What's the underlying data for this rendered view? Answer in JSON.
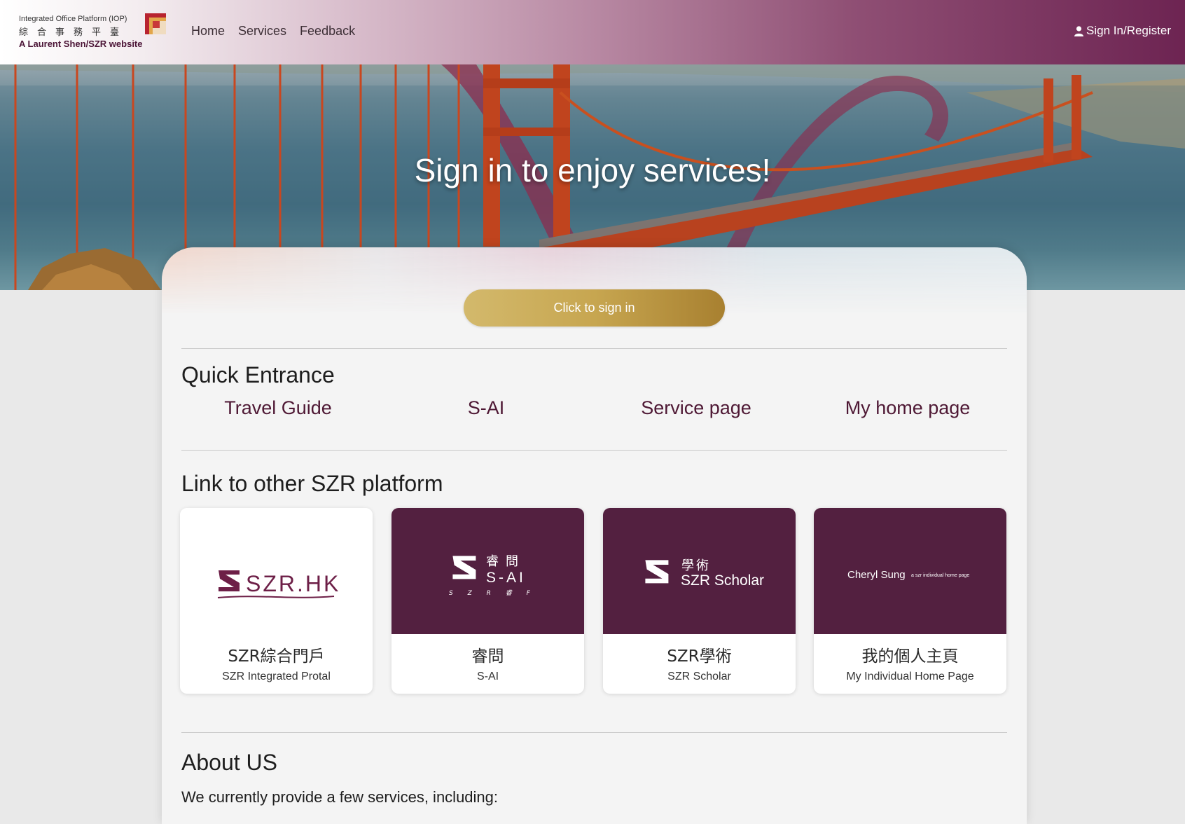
{
  "header": {
    "logo_en": "Integrated Office Platform (IOP)",
    "logo_zh": "綜合事務平臺",
    "logo_sub": "A Laurent Shen/SZR website",
    "nav": [
      "Home",
      "Services",
      "Feedback"
    ],
    "signin_label": "Sign In/Register"
  },
  "hero": {
    "title": "Sign in to enjoy services!"
  },
  "main": {
    "signin_button": "Click to sign in",
    "quick_entrance": {
      "title": "Quick Entrance",
      "links": [
        "Travel Guide",
        "S-AI",
        "Service page",
        "My home page"
      ]
    },
    "platforms": {
      "title": "Link to other SZR platform",
      "cards": [
        {
          "logo_text": "SZR.HK",
          "title": "SZR綜合門戶",
          "subtitle": "SZR Integrated Protal"
        },
        {
          "logo_text": "S-AI",
          "logo_zh": "睿問",
          "logo_small": "S Z R 睿 F",
          "title": "睿問",
          "subtitle": "S-AI"
        },
        {
          "logo_text": "SZR Scholar",
          "logo_zh": "學術",
          "title": "SZR學術",
          "subtitle": "SZR Scholar"
        },
        {
          "logo_text": "Cheryl Sung",
          "logo_small": "a szr individual home page",
          "title": "我的個人主頁",
          "subtitle": "My Individual Home Page"
        }
      ]
    },
    "about": {
      "title": "About US",
      "text": "We currently provide a few services, including:"
    }
  },
  "colors": {
    "brand": "#532040",
    "link": "#4e1834",
    "button_gold": "#c7a650"
  }
}
